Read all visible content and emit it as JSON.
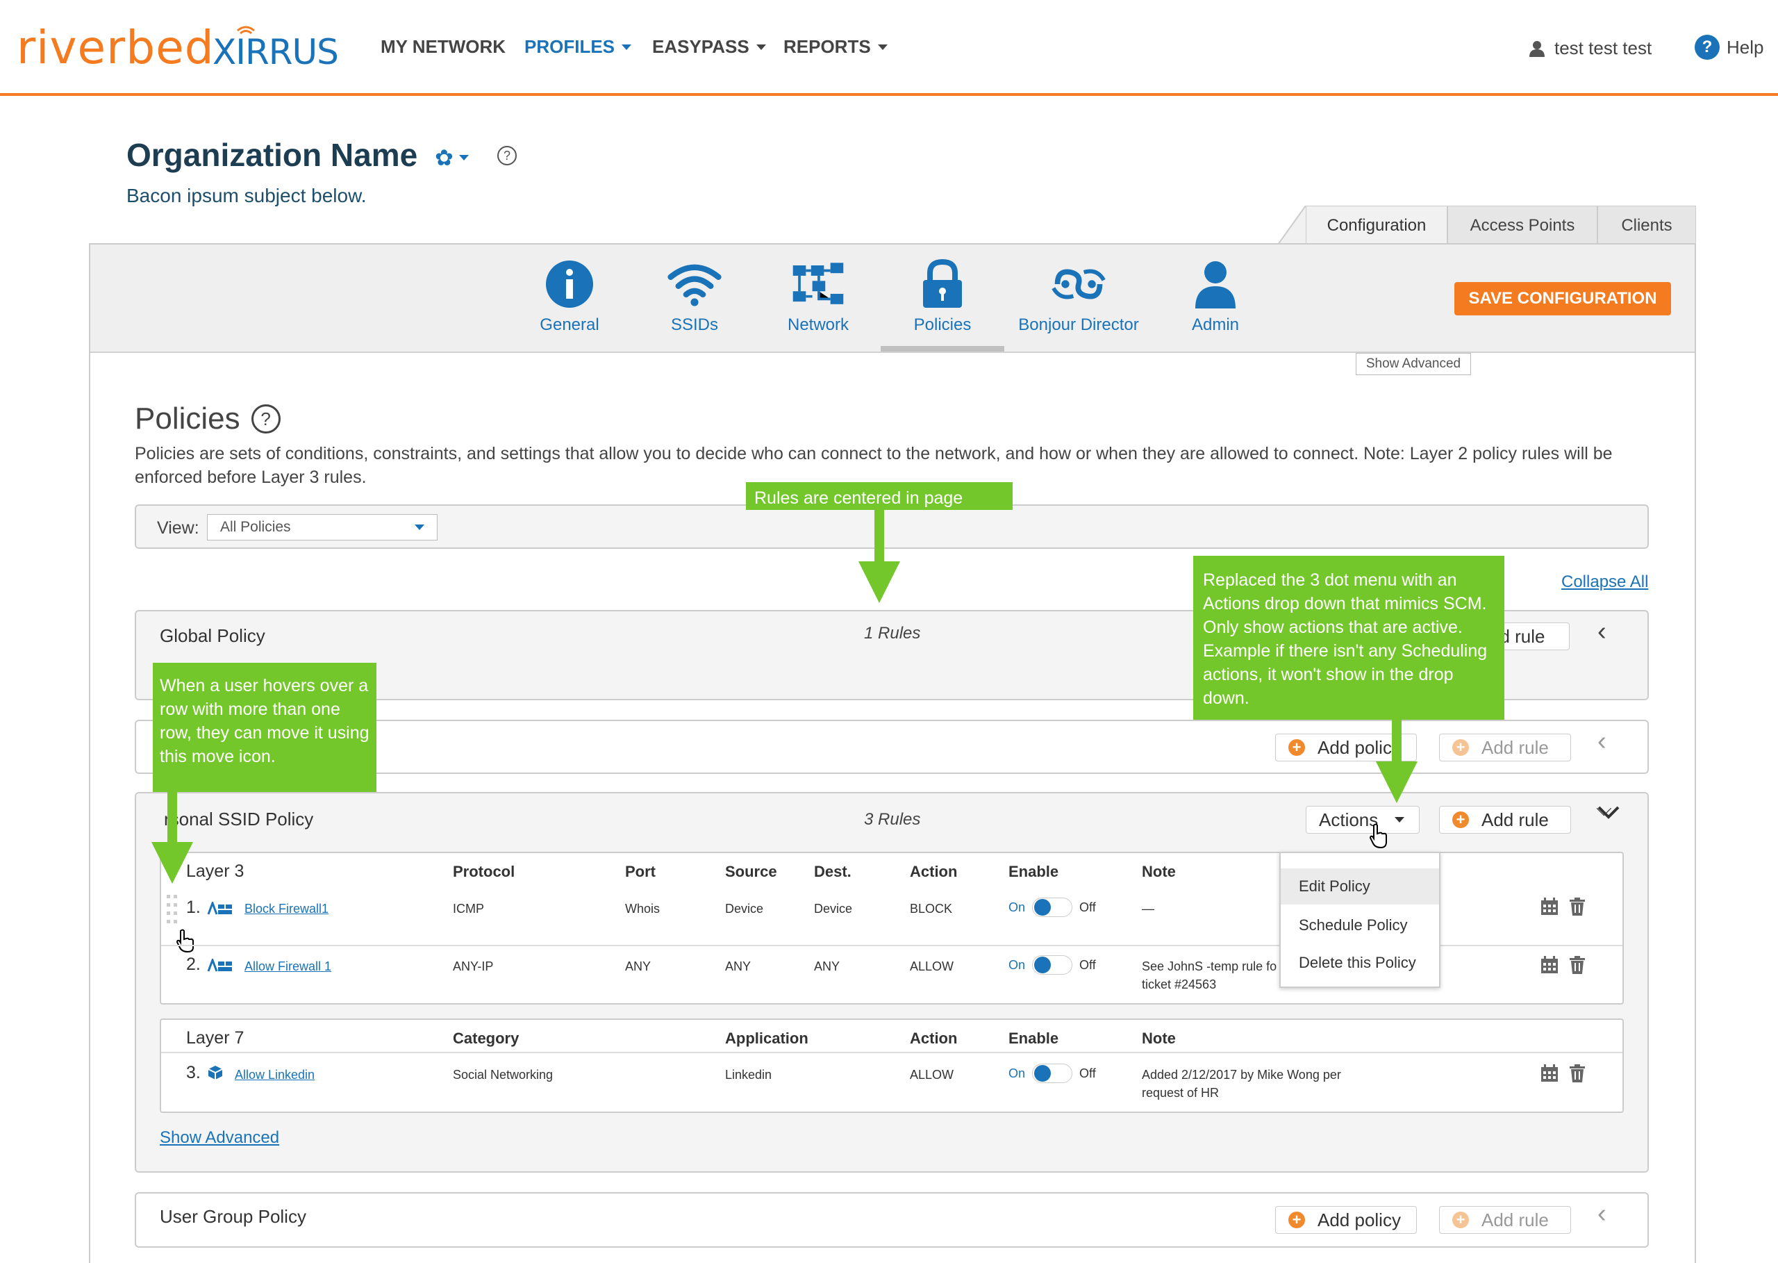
{
  "brand": {
    "logo_primary": "riverbed",
    "logo_secondary": "XIRRUS",
    "accent": "#f47b20",
    "link": "#1a73b8"
  },
  "nav": {
    "items": [
      {
        "label": "MY NETWORK",
        "active": false
      },
      {
        "label": "PROFILES",
        "active": true
      },
      {
        "label": "EASYPASS",
        "active": false
      },
      {
        "label": "REPORTS",
        "active": false
      }
    ],
    "user": "test test test",
    "help": "Help"
  },
  "org": {
    "title": "Organization Name",
    "subtitle": "Bacon ipsum subject below."
  },
  "config_tabs": [
    "Configuration",
    "Access Points",
    "Clients"
  ],
  "config_icons": [
    "General",
    "SSIDs",
    "Network",
    "Policies",
    "Bonjour Director",
    "Admin"
  ],
  "save_label": "SAVE CONFIGURATION",
  "show_advanced_top": "Show Advanced",
  "policies": {
    "title": "Policies",
    "description": "Policies are sets of conditions, constraints, and settings that allow you to decide who can connect to the network, and how or when they are allowed to connect. Note: Layer 2 policy rules will be enforced before Layer 3 rules.",
    "view_label": "View:",
    "view_value": "All Policies",
    "collapse_all": "Collapse All"
  },
  "blocks": {
    "global": {
      "name": "Global Policy",
      "rules": "1 Rules",
      "add_rule_partial": "dd rule"
    },
    "second": {
      "add_policy_partial": "Add polic",
      "add_rule": "Add rule"
    },
    "personal": {
      "name_partial": "rsonal SSID Policy",
      "rules": "3 Rules",
      "actions": "Actions",
      "add_rule": "Add rule",
      "show_advanced": "Show Advanced"
    },
    "user_group": {
      "name": "User Group Policy",
      "add_policy": "Add policy",
      "add_rule": "Add rule"
    }
  },
  "layer3": {
    "headers": [
      "Layer 3",
      "Protocol",
      "Port",
      "Source",
      "Dest.",
      "Action",
      "Enable",
      "Note"
    ],
    "rows": [
      {
        "num": "1.",
        "name": "Block Firewall1",
        "protocol": "ICMP",
        "port": "Whois",
        "source": "Device",
        "dest": "Device",
        "action": "BLOCK",
        "on": "On",
        "off": "Off",
        "note": "—"
      },
      {
        "num": "2.",
        "name": "Allow Firewall 1",
        "protocol": "ANY-IP",
        "port": "ANY",
        "source": "ANY",
        "dest": "ANY",
        "action": "ALLOW",
        "on": "On",
        "off": "Off",
        "note_line1": "See JohnS -temp rule fo",
        "note_line2": "ticket #24563"
      }
    ]
  },
  "layer7": {
    "headers": [
      "Layer 7",
      "Category",
      "Application",
      "Action",
      "Enable",
      "Note"
    ],
    "rows": [
      {
        "num": "3.",
        "name": "Allow Linkedin",
        "category": "Social Networking",
        "application": "Linkedin",
        "action": "ALLOW",
        "on": "On",
        "off": "Off",
        "note_line1": "Added 2/12/2017 by Mike Wong per",
        "note_line2": "request of HR"
      }
    ]
  },
  "actions_menu": [
    "Edit Policy",
    "Schedule Policy",
    "Delete this Policy"
  ],
  "annotations": {
    "centered": "Rules are centered in page",
    "actions": "Replaced the 3 dot menu with an Actions drop down that mimics SCM. Only show actions that are active. Example if there isn't any Scheduling actions, it won't show in the drop down.",
    "move": "When a user hovers over a row with more than one row, they can move it using this move icon."
  }
}
